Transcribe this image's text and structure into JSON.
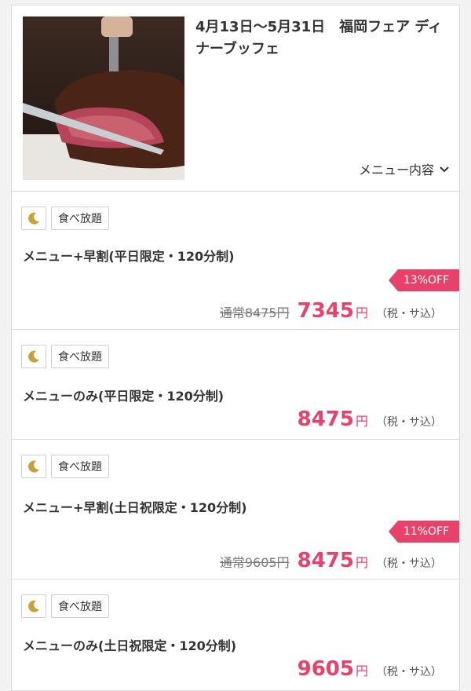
{
  "header": {
    "title": "4月13日〜5月31日　福岡フェア ディナーブッフェ",
    "menu_toggle_label": "メニュー内容"
  },
  "plans": [
    {
      "tag": "食べ放題",
      "name": "メニュー+早割(平日限定・120分制)",
      "discount": "13%OFF",
      "original_price": "通常8475円",
      "price": "7345",
      "yen": "円",
      "tax": "（税・サ込）"
    },
    {
      "tag": "食べ放題",
      "name": "メニューのみ(平日限定・120分制)",
      "discount": "",
      "original_price": "",
      "price": "8475",
      "yen": "円",
      "tax": "（税・サ込）"
    },
    {
      "tag": "食べ放題",
      "name": "メニュー+早割(土日祝限定・120分制)",
      "discount": "11%OFF",
      "original_price": "通常9605円",
      "price": "8475",
      "yen": "円",
      "tax": "（税・サ込）"
    },
    {
      "tag": "食べ放題",
      "name": "メニューのみ(土日祝限定・120分制)",
      "discount": "",
      "original_price": "",
      "price": "9605",
      "yen": "円",
      "tax": "（税・サ込）"
    }
  ],
  "icons": {
    "meal_time": "moon-icon",
    "toggle": "chevron-down-icon"
  },
  "colors": {
    "accent": "#e8416a",
    "moon": "#c9a13c"
  }
}
